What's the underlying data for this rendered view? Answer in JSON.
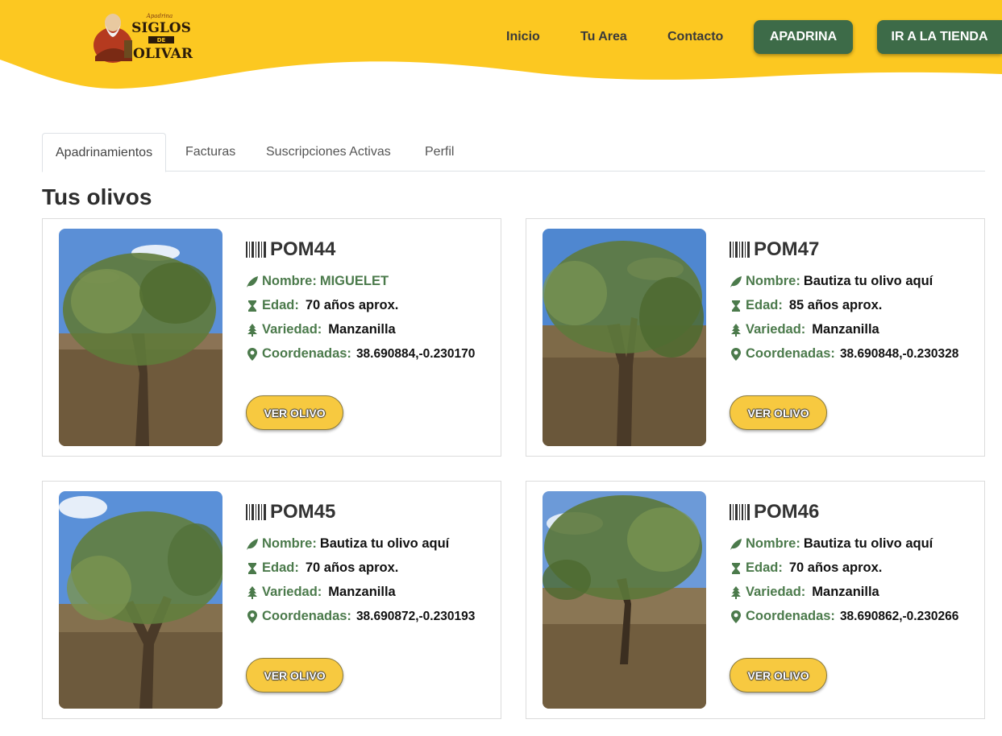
{
  "brand": {
    "logo_small": "Apadrina",
    "logo_line1": "SIGLOS",
    "logo_line2": "DE",
    "logo_line3": "OLIVAR",
    "accent_yellow": "#fcc821",
    "accent_green": "#3d6b48",
    "label_green": "#4b7a4b"
  },
  "nav": {
    "inicio": "Inicio",
    "tu_area": "Tu Area",
    "contacto": "Contacto",
    "apadrina": "APADRINA",
    "tienda": "IR A LA TIENDA"
  },
  "tabs": {
    "apadrinamientos": "Apadrinamientos",
    "facturas": "Facturas",
    "suscripciones": "Suscripciones Activas",
    "perfil": "Perfil"
  },
  "section_title": "Tus olivos",
  "labels": {
    "nombre": "Nombre:",
    "edad": "Edad:",
    "variedad": "Variedad:",
    "coordenadas": "Coordenadas:",
    "ver_olivo": "VER OLIVO"
  },
  "icons": {
    "code": "barcode-icon",
    "nombre": "leaf-icon",
    "edad": "hourglass-icon",
    "variedad": "tree-icon",
    "coordenadas": "map-marker-icon"
  },
  "olivos": [
    {
      "codigo": "POM44",
      "nombre": "MIGUELET",
      "edad": "70 años aprox.",
      "variedad": "Manzanilla",
      "coordenadas": "38.690884,-0.230170"
    },
    {
      "codigo": "POM47",
      "nombre": "Bautiza tu olivo aquí",
      "edad": "85 años aprox.",
      "variedad": "Manzanilla",
      "coordenadas": "38.690848,-0.230328"
    },
    {
      "codigo": "POM45",
      "nombre": "Bautiza tu olivo aquí",
      "edad": "70 años aprox.",
      "variedad": "Manzanilla",
      "coordenadas": "38.690872,-0.230193"
    },
    {
      "codigo": "POM46",
      "nombre": "Bautiza tu olivo aquí",
      "edad": "70 años aprox.",
      "variedad": "Manzanilla",
      "coordenadas": "38.690862,-0.230266"
    }
  ]
}
